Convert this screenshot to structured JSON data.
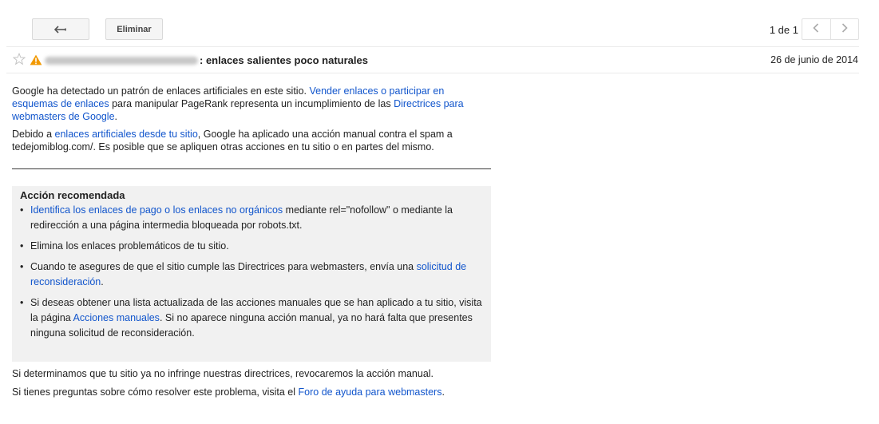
{
  "toolbar": {
    "back_icon": "reply-arrow-icon",
    "delete_label": "Eliminar",
    "pager_text": "1 de 1",
    "prev_icon": "chevron-left-icon",
    "next_icon": "chevron-right-icon"
  },
  "message": {
    "sender_blurred": true,
    "subject": ": enlaces salientes poco naturales",
    "date": "26 de junio de 2014",
    "star_icon": "star-icon",
    "warning_icon": "warning-icon",
    "warning_color": "#f29900"
  },
  "body": {
    "p1_a": "Google ha detectado un patrón de enlaces artificiales en este sitio. ",
    "p1_link1": "Vender enlaces o participar en esquemas de enlaces",
    "p1_b": " para manipular PageRank representa un incumplimiento de las ",
    "p1_link2": "Directrices para webmasters de Google",
    "p1_c": ".",
    "p2_a": "Debido a ",
    "p2_link": "enlaces artificiales desde tu sitio",
    "p2_b": ", Google ha aplicado una acción manual contra el spam a tedejomiblog.com/. Es posible que se apliquen otras acciones en tu sitio o en partes del mismo."
  },
  "recommended": {
    "title": "Acción recomendada",
    "bullet": "•",
    "item1_link": "Identifica los enlaces de pago o los enlaces no orgánicos",
    "item1_text": " mediante rel=\"nofollow\" o mediante la redirección a una página intermedia bloqueada por robots.txt.",
    "item2_text": "Elimina los enlaces problemáticos de tu sitio.",
    "item3_text": "Cuando te asegures de que el sitio cumple las Directrices para webmasters, envía una ",
    "item3_link": "solicitud de reconsideración",
    "item3_end": ".",
    "item4_text": "Si deseas obtener una lista actualizada de las acciones manuales que se han aplicado a tu sitio, visita la página ",
    "item4_link": "Acciones manuales",
    "item4_end": ". Si no aparece ninguna acción manual, ya no hará falta que presentes ninguna solicitud de reconsideración."
  },
  "footer": {
    "line1": "Si determinamos que tu sitio ya no infringe nuestras directrices, revocaremos la acción manual.",
    "line2_a": "Si tienes preguntas sobre cómo resolver este problema, visita el ",
    "line2_link": "Foro de ayuda para webmasters",
    "line2_b": "."
  },
  "colors": {
    "link": "#1155cc",
    "rec_background": "#f1f1f1"
  }
}
